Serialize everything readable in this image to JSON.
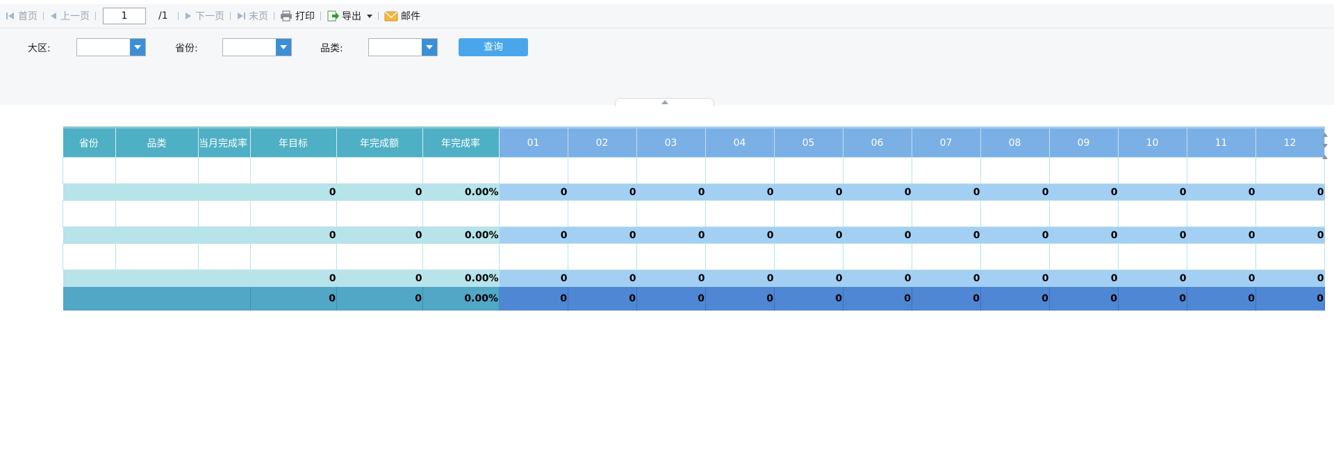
{
  "toolbar": {
    "first_label": "首页",
    "prev_label": "上一页",
    "page_value": "1",
    "page_total": "/1",
    "next_label": "下一页",
    "last_label": "末页",
    "print_label": "打印",
    "export_label": "导出",
    "mail_label": "邮件"
  },
  "filters": {
    "region_label": "大区:",
    "region_value": "",
    "province_label": "省份:",
    "province_value": "",
    "category_label": "品类:",
    "category_value": "",
    "query_label": "查询"
  },
  "colors": {
    "header_teal": "#4fafc4",
    "header_month": "#7ab0e6",
    "subtotal_teal": "#b7e3eb",
    "subtotal_month": "#a3cff3",
    "total_teal": "#52a6c6",
    "total_month": "#4f87d4",
    "query_button": "#49a6ea"
  },
  "table": {
    "headers": [
      "省份",
      "品类",
      "当月完成率",
      "年目标",
      "年完成额",
      "年完成率",
      "01",
      "02",
      "03",
      "04",
      "05",
      "06",
      "07",
      "08",
      "09",
      "10",
      "11",
      "12"
    ],
    "subtotal_rows": [
      {
        "year_target": "0",
        "year_done": "0",
        "year_rate": "0.00%",
        "rate_col": "0",
        "months": [
          "0",
          "0",
          "0",
          "0",
          "0",
          "0",
          "0",
          "0",
          "0",
          "0",
          "0"
        ]
      },
      {
        "year_target": "0",
        "year_done": "0",
        "year_rate": "0.00%",
        "rate_col": "0",
        "months": [
          "0",
          "0",
          "0",
          "0",
          "0",
          "0",
          "0",
          "0",
          "0",
          "0",
          "0"
        ]
      },
      {
        "year_target": "0",
        "year_done": "0",
        "year_rate": "0.00%",
        "rate_col": "0",
        "months": [
          "0",
          "0",
          "0",
          "0",
          "0",
          "0",
          "0",
          "0",
          "0",
          "0",
          "0"
        ]
      }
    ],
    "total_row": {
      "year_target": "0",
      "year_done": "0",
      "year_rate": "0.00%",
      "rate_col": "0",
      "months": [
        "0",
        "0",
        "0",
        "0",
        "0",
        "0",
        "0",
        "0",
        "0",
        "0",
        "0"
      ]
    }
  }
}
